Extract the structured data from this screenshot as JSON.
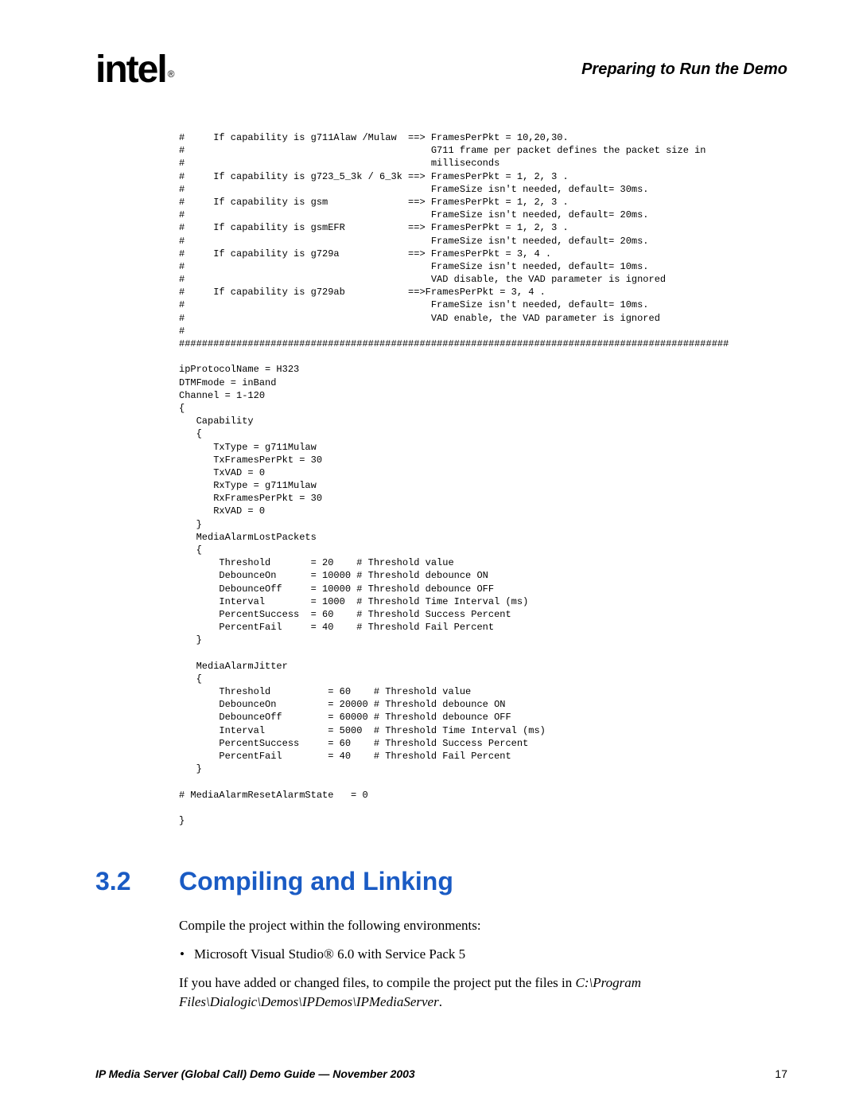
{
  "header": {
    "logo_text": "intel",
    "running_head": "Preparing to Run the Demo"
  },
  "code": {
    "text": "#     If capability is g711Alaw /Mulaw  ==> FramesPerPkt = 10,20,30.\n#                                           G711 frame per packet defines the packet size in\n#                                           milliseconds\n#     If capability is g723_5_3k / 6_3k ==> FramesPerPkt = 1, 2, 3 .\n#                                           FrameSize isn't needed, default= 30ms.\n#     If capability is gsm              ==> FramesPerPkt = 1, 2, 3 .\n#                                           FrameSize isn't needed, default= 20ms.\n#     If capability is gsmEFR           ==> FramesPerPkt = 1, 2, 3 .\n#                                           FrameSize isn't needed, default= 20ms.\n#     If capability is g729a            ==> FramesPerPkt = 3, 4 .\n#                                           FrameSize isn't needed, default= 10ms.\n#                                           VAD disable, the VAD parameter is ignored\n#     If capability is g729ab           ==>FramesPerPkt = 3, 4 .\n#                                           FrameSize isn't needed, default= 10ms.\n#                                           VAD enable, the VAD parameter is ignored\n#\n################################################################################################\n\nipProtocolName = H323\nDTMFmode = inBand\nChannel = 1-120\n{\n   Capability\n   {\n      TxType = g711Mulaw\n      TxFramesPerPkt = 30\n      TxVAD = 0\n      RxType = g711Mulaw\n      RxFramesPerPkt = 30\n      RxVAD = 0\n   }\n   MediaAlarmLostPackets\n   {\n       Threshold       = 20    # Threshold value\n       DebounceOn      = 10000 # Threshold debounce ON\n       DebounceOff     = 10000 # Threshold debounce OFF\n       Interval        = 1000  # Threshold Time Interval (ms)\n       PercentSuccess  = 60    # Threshold Success Percent\n       PercentFail     = 40    # Threshold Fail Percent\n   }\n\n   MediaAlarmJitter\n   {\n       Threshold          = 60    # Threshold value\n       DebounceOn         = 20000 # Threshold debounce ON\n       DebounceOff        = 60000 # Threshold debounce OFF\n       Interval           = 5000  # Threshold Time Interval (ms)\n       PercentSuccess     = 60    # Threshold Success Percent\n       PercentFail        = 40    # Threshold Fail Percent\n   }\n\n# MediaAlarmResetAlarmState   = 0\n\n}"
  },
  "section": {
    "num": "3.2",
    "title": "Compiling and Linking",
    "para1": "Compile the project within the following environments:",
    "bullet1": "Microsoft Visual Studio® 6.0 with Service Pack 5",
    "para2_a": "If you have added or changed files, to compile the project put the files in ",
    "para2_b": "C:\\Program Files\\Dialogic\\Demos\\IPDemos\\IPMediaServer",
    "para2_c": "."
  },
  "footer": {
    "left": "IP Media Server (Global Call) Demo Guide — November 2003",
    "page": "17"
  }
}
